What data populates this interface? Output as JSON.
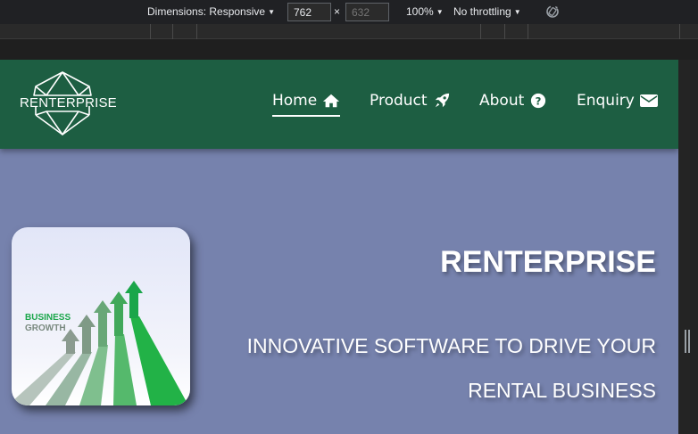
{
  "devtools": {
    "dimensions_label": "Dimensions: Responsive",
    "width_value": "762",
    "height_value": "632",
    "zoom": "100%",
    "throttling": "No throttling"
  },
  "navbar": {
    "logo_text": "RENTERPRISE",
    "items": [
      {
        "label": "Home",
        "icon": "home-icon",
        "active": true
      },
      {
        "label": "Product",
        "icon": "rocket-icon",
        "active": false
      },
      {
        "label": "About",
        "icon": "question-circle-icon",
        "active": false
      },
      {
        "label": "Enquiry",
        "icon": "envelope-icon",
        "active": false
      }
    ]
  },
  "hero": {
    "title": "RENTERPRISE",
    "subtitle": "INNOVATIVE SOFTWARE TO DRIVE YOUR RENTAL BUSINESS",
    "image_text_line1": "BUSINESS",
    "image_text_line2": "GROWTH"
  },
  "colors": {
    "navbar_bg": "#1d5e42",
    "hero_bg": "#7682ad",
    "accent_green": "#1aa64a"
  }
}
